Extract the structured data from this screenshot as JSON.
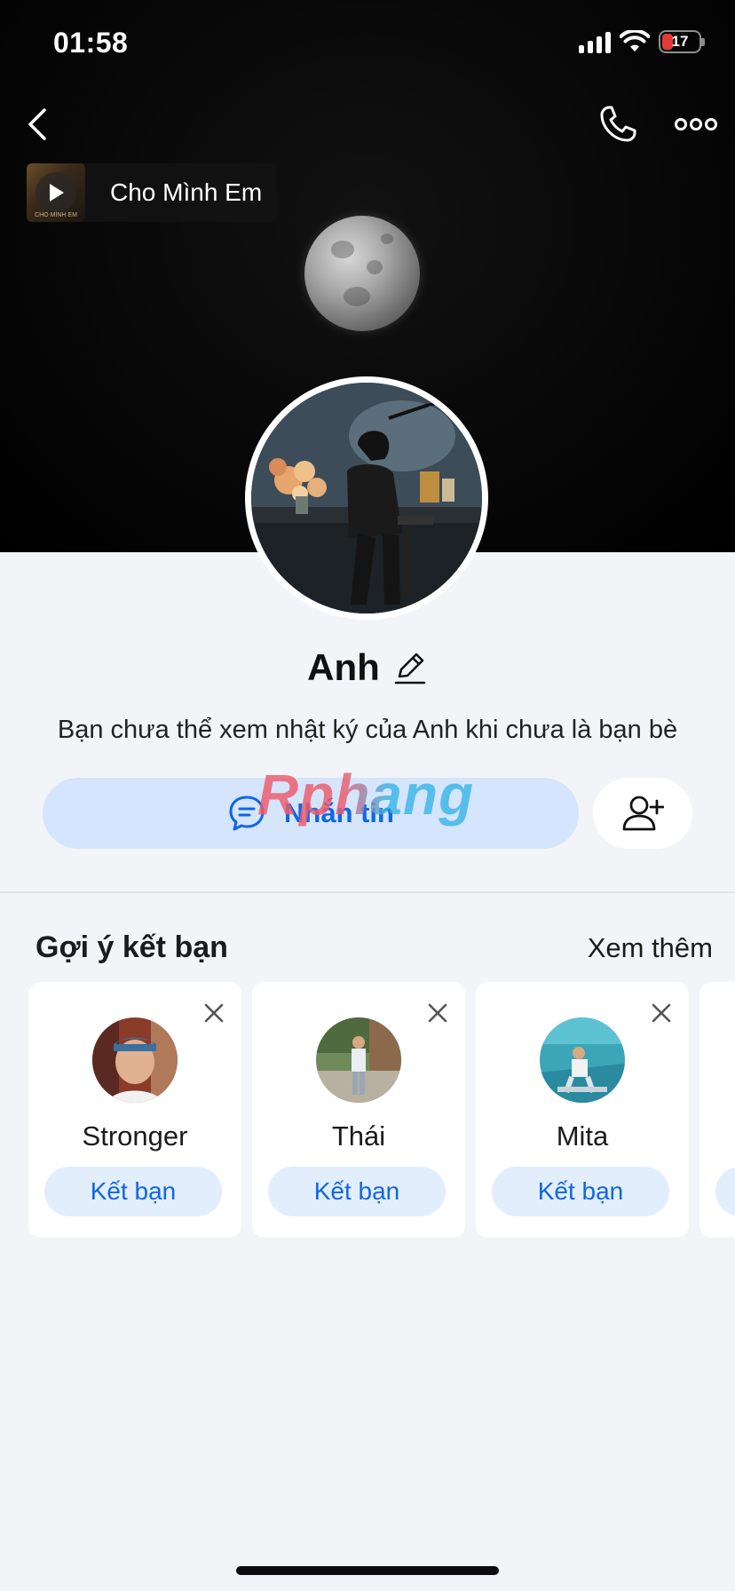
{
  "status_bar": {
    "time": "01:58",
    "battery": "17"
  },
  "header": {
    "music": {
      "title": "Cho Mình Em",
      "thumb_caption": "CHO MÌNH EM"
    }
  },
  "profile": {
    "name": "Anh",
    "info": "Bạn chưa thể xem nhật ký của Anh khi chưa là bạn bè",
    "message_label": "Nhắn tin"
  },
  "watermark": "Rphang",
  "suggestions": {
    "title": "Gợi ý kết bạn",
    "see_more": "Xem thêm",
    "items": [
      {
        "name": "Stronger",
        "button": "Kết bạn"
      },
      {
        "name": "Thái",
        "button": "Kết bạn"
      },
      {
        "name": "Mita",
        "button": "Kết bạn"
      }
    ]
  },
  "colors": {
    "accent": "#1066e4",
    "message_button_bg": "#d4e5fd",
    "card_button_bg": "#e3eefd",
    "background": "#f3f4f7"
  },
  "icons": [
    "back-icon",
    "phone-icon",
    "more-icon",
    "play-icon",
    "edit-icon",
    "chat-icon",
    "add-friend-icon",
    "close-icon"
  ]
}
